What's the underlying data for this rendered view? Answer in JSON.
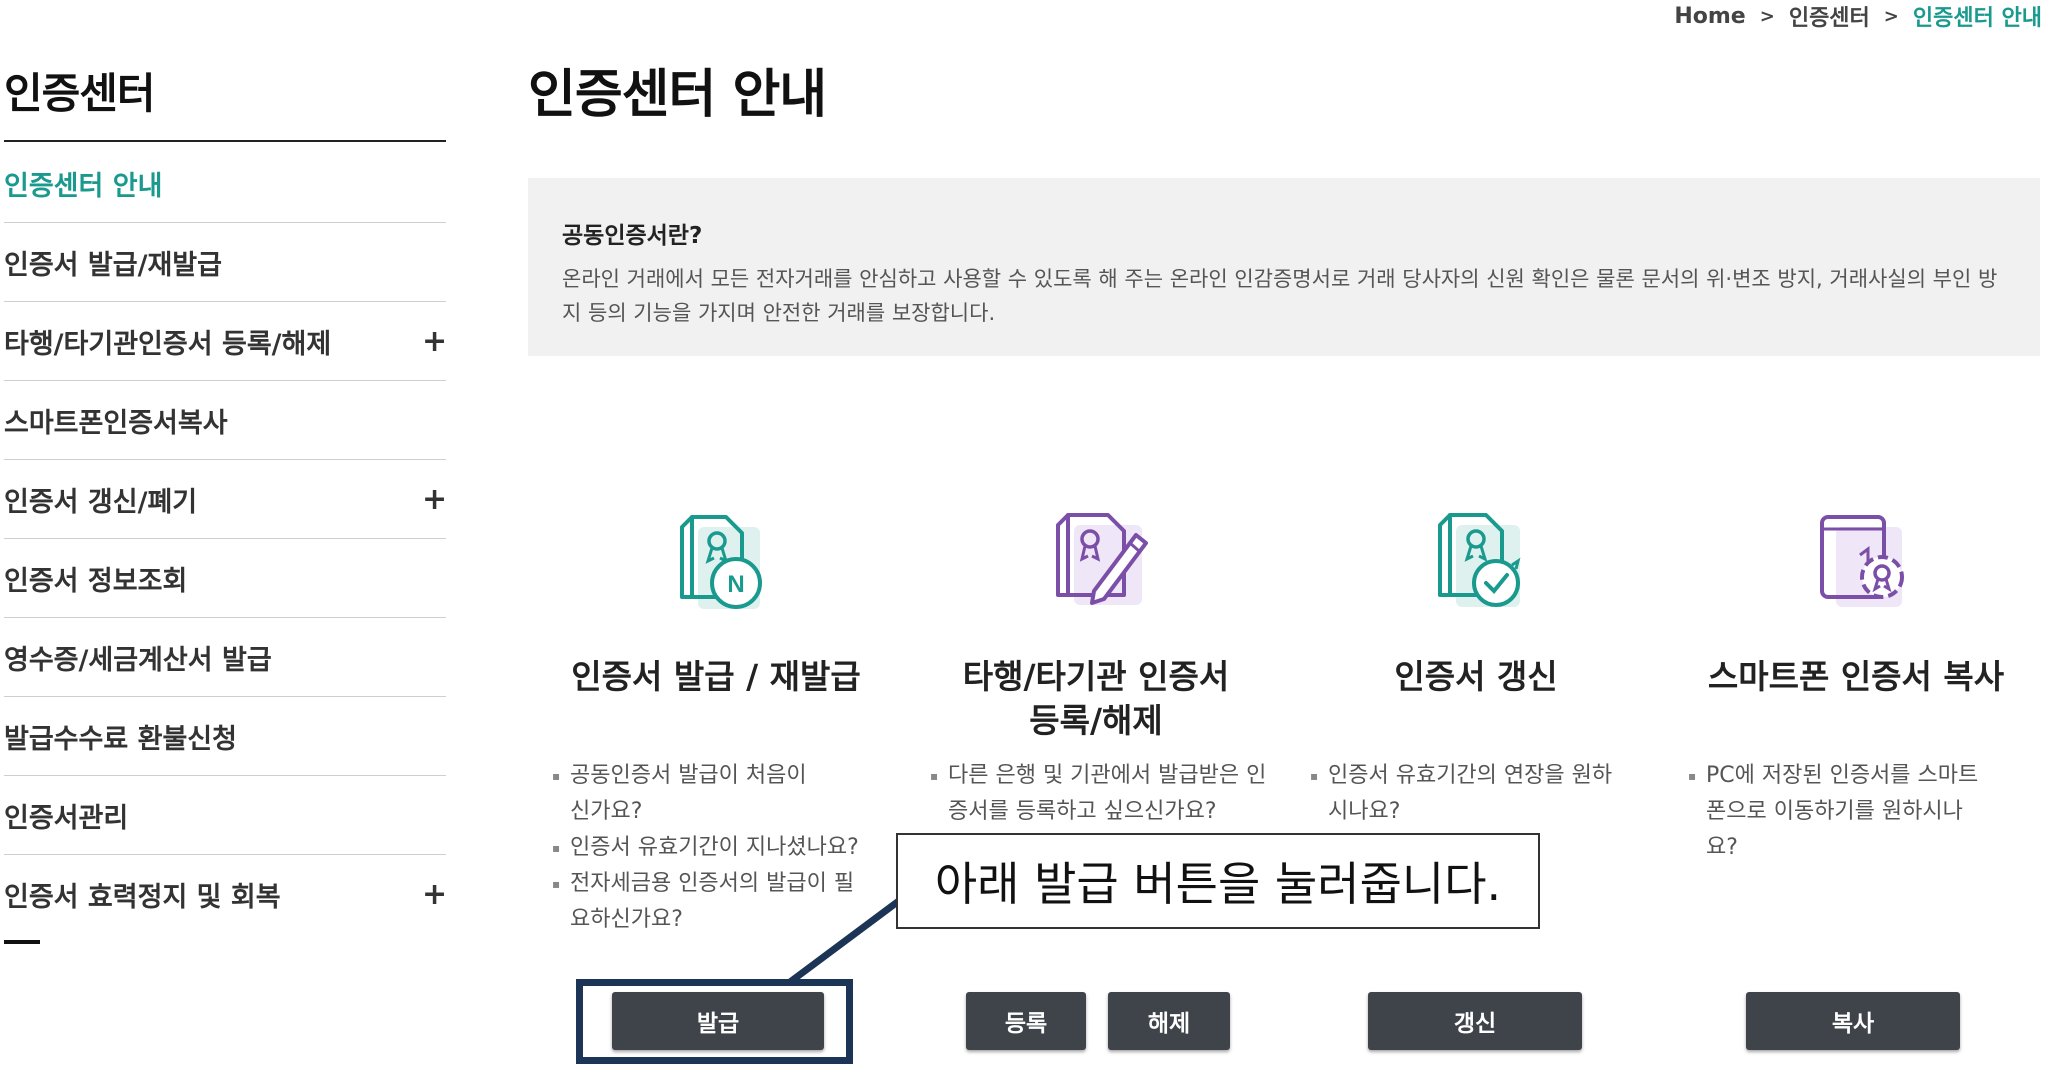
{
  "breadcrumb": {
    "home": "Home",
    "level1": "인증센터",
    "current": "인증센터 안내"
  },
  "sidebar": {
    "title": "인증센터",
    "items": [
      {
        "label": "인증서 발급/재발급",
        "expandable": false
      },
      {
        "label": "타행/타기관인증서 등록/해제",
        "expandable": true
      },
      {
        "label": "스마트폰인증서복사",
        "expandable": false
      },
      {
        "label": "인증서 갱신/폐기",
        "expandable": true
      },
      {
        "label": "인증서 정보조회",
        "expandable": false
      },
      {
        "label": "영수증/세금계산서 발급",
        "expandable": false
      },
      {
        "label": "발급수수료 환불신청",
        "expandable": false
      },
      {
        "label": "인증서관리",
        "expandable": false
      },
      {
        "label": "인증서 효력정지 및 회복",
        "expandable": true
      }
    ],
    "active_label": "인증센터 안내",
    "plus_symbol": "+"
  },
  "main": {
    "page_title": "인증센터 안내",
    "info": {
      "title": "공동인증서란?",
      "description": "온라인 거래에서 모든 전자거래를 안심하고 사용할 수 있도록 해 주는 온라인 인감증명서로 거래 당사자의 신원 확인은 물론 문서의 위·변조 방지, 거래사실의 부인 방지 등의 기능을 가지며 안전한 거래를 보장합니다."
    },
    "cards": [
      {
        "title": "인증서 발급 / 재발급",
        "icon": "certificate-n-icon",
        "bullets": [
          "공동인증서 발급이 처음이신가요?",
          "인증서 유효기간이 지나셨나요?",
          "전자세금용 인증서의 발급이 필요하신가요?"
        ],
        "buttons": [
          "발급"
        ]
      },
      {
        "title": "타행/타기관 인증서 등록/해제",
        "icon": "certificate-pen-icon",
        "bullets": [
          "다른 은행 및 기관에서 발급받은 인증서를 등록하고 싶으신가요?"
        ],
        "buttons": [
          "등록",
          "해제"
        ]
      },
      {
        "title": "인증서 갱신",
        "icon": "certificate-renew-icon",
        "bullets": [
          "인증서 유효기간의 연장을 원하시나요?"
        ],
        "buttons": [
          "갱신"
        ]
      },
      {
        "title": "스마트폰 인증서 복사",
        "icon": "certificate-copy-icon",
        "bullets": [
          "PC에 저장된 인증서를 스마트폰으로 이동하기를 원하시나요?"
        ],
        "buttons": [
          "복사"
        ]
      }
    ]
  },
  "annotation": {
    "callout_text": "아래 발급 버튼을 눌러줍니다."
  },
  "colors": {
    "accent": "#1a9a8e",
    "icon_teal": "#1a9a8e",
    "icon_purple": "#7b4fa8",
    "button_bg": "#3e444a",
    "highlight_border": "#1c3557",
    "info_bg": "#f1f1f1"
  }
}
